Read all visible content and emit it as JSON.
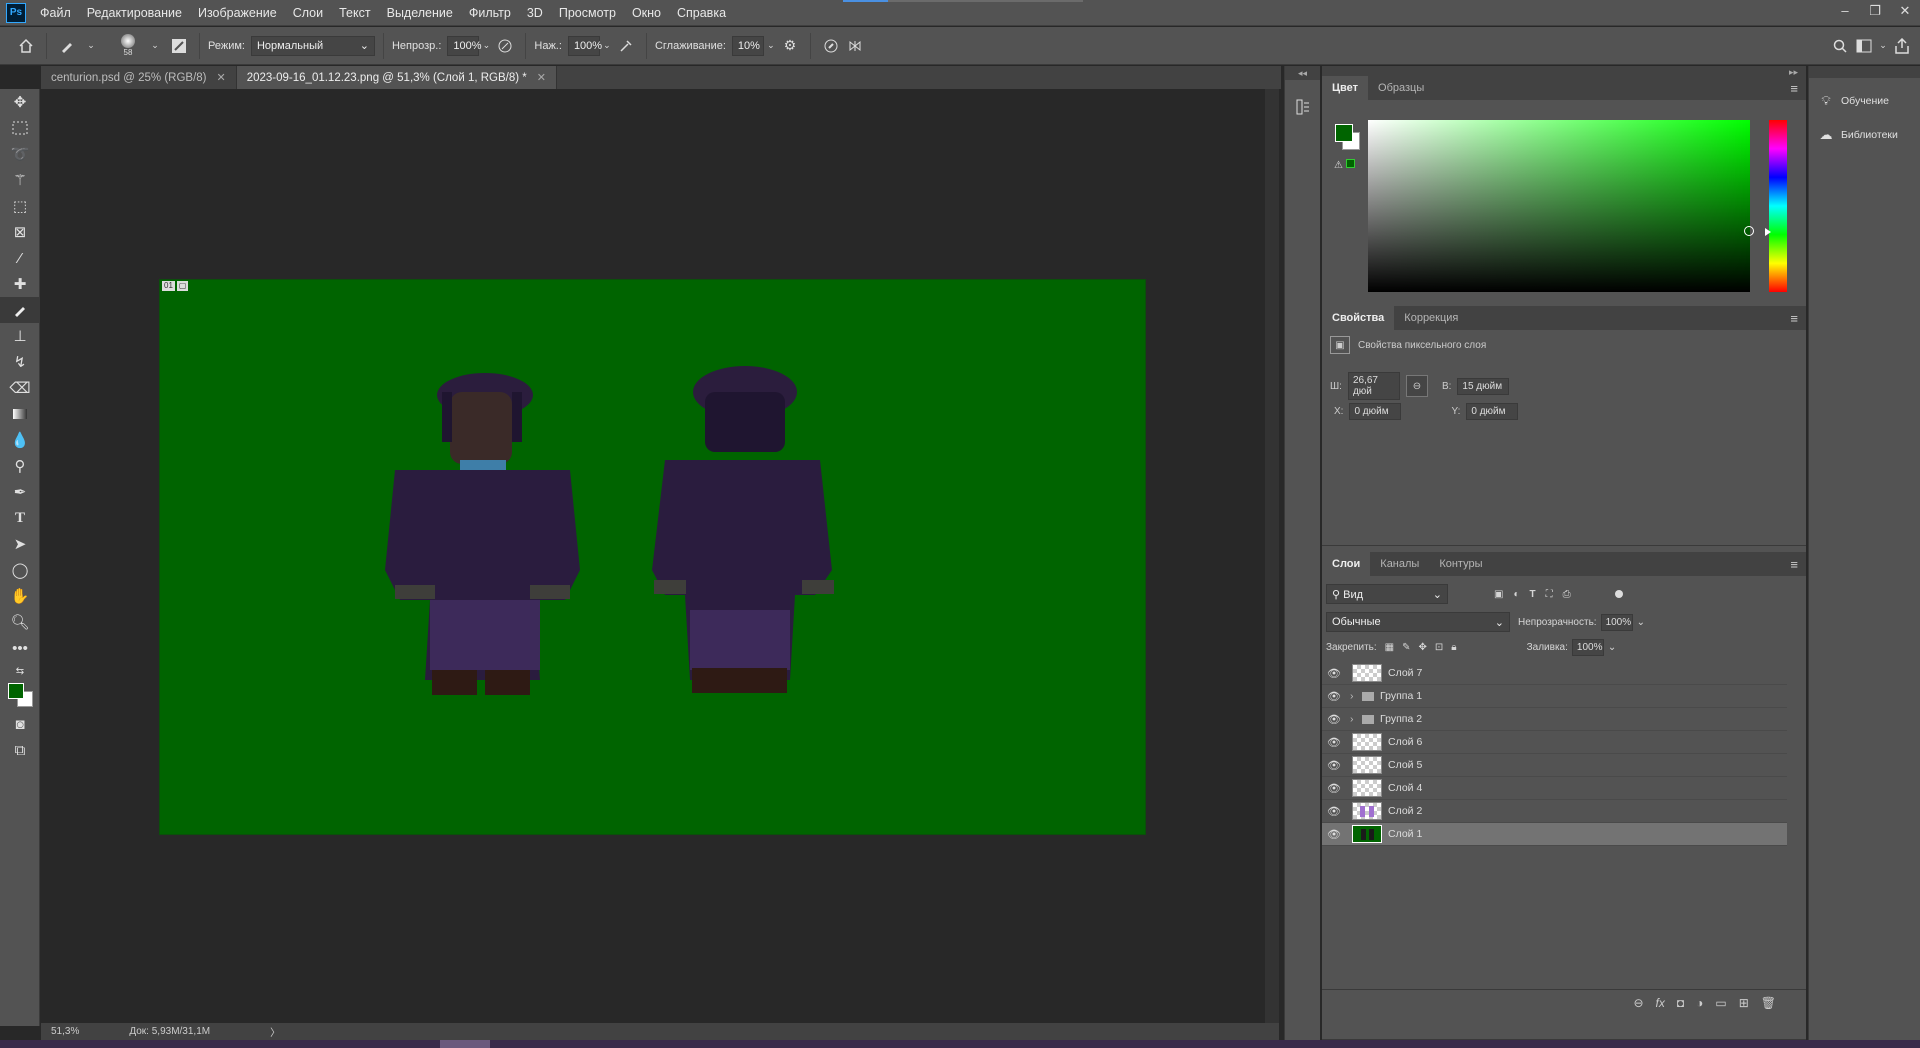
{
  "app": {
    "logo": "Ps",
    "theme_color": "#535353",
    "accent": "#31a8ff"
  },
  "menu": [
    "Файл",
    "Редактирование",
    "Изображение",
    "Слои",
    "Текст",
    "Выделение",
    "Фильтр",
    "3D",
    "Просмотр",
    "Окно",
    "Справка"
  ],
  "window_controls": {
    "minimize": "–",
    "restore": "❐",
    "close": "✕"
  },
  "options": {
    "brush_size": "58",
    "mode_label": "Режим:",
    "mode_value": "Нормальный",
    "opacity_label": "Непрозр.:",
    "opacity_value": "100%",
    "flow_label": "Наж.:",
    "flow_value": "100%",
    "smoothing_label": "Сглаживание:",
    "smoothing_value": "10%"
  },
  "tabs": [
    {
      "label": "centurion.psd @ 25% (RGB/8)",
      "active": false
    },
    {
      "label": "2023-09-16_01.12.23.png @ 51,3% (Слой 1, RGB/8) *",
      "active": true
    }
  ],
  "canvas": {
    "background": "#006400",
    "badge1": "01",
    "badge2": "▢"
  },
  "status": {
    "zoom": "51,3%",
    "doc": "Док: 5,93M/31,1M",
    "arrow": "〉"
  },
  "color_panel": {
    "tabs": [
      "Цвет",
      "Образцы"
    ],
    "foreground": "#006400",
    "background": "#ffffff"
  },
  "properties_panel": {
    "tabs": [
      "Свойства",
      "Коррекция"
    ],
    "title": "Свойства пиксельного слоя",
    "w_label": "Ш:",
    "w_value": "26,67 дюй",
    "h_label": "В:",
    "h_value": "15 дюйм",
    "x_label": "X:",
    "x_value": "0 дюйм",
    "y_label": "Y:",
    "y_value": "0 дюйм"
  },
  "layers_panel": {
    "tabs": [
      "Слои",
      "Каналы",
      "Контуры"
    ],
    "filter_value": "Вид",
    "blend_mode": "Обычные",
    "opacity_label": "Непрозрачность:",
    "opacity_value": "100%",
    "lock_label": "Закрепить:",
    "fill_label": "Заливка:",
    "fill_value": "100%",
    "layers": [
      {
        "name": "Слой 7",
        "type": "layer",
        "thumb": "transparent"
      },
      {
        "name": "Группа 1",
        "type": "group"
      },
      {
        "name": "Группа 2",
        "type": "group"
      },
      {
        "name": "Слой 6",
        "type": "layer",
        "thumb": "transparent"
      },
      {
        "name": "Слой 5",
        "type": "layer",
        "thumb": "transparent"
      },
      {
        "name": "Слой 4",
        "type": "layer",
        "thumb": "transparent"
      },
      {
        "name": "Слой 2",
        "type": "layer",
        "thumb": "purple"
      },
      {
        "name": "Слой 1",
        "type": "layer",
        "thumb": "green",
        "selected": true
      }
    ]
  },
  "side_panel": {
    "learn": "Обучение",
    "libraries": "Библиотеки"
  }
}
